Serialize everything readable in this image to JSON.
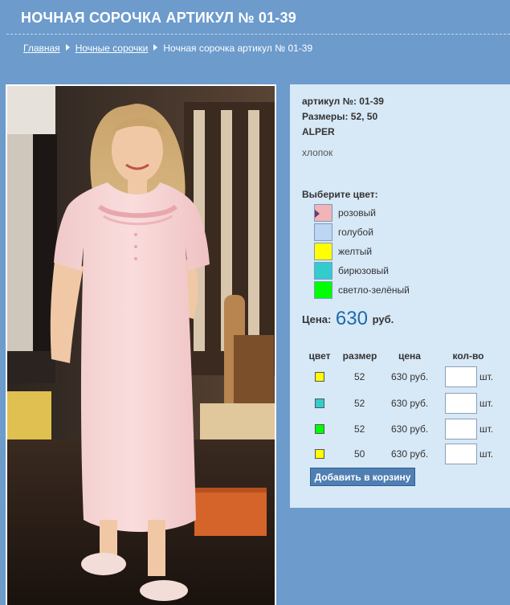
{
  "page": {
    "title": "НОЧНАЯ СОРОЧКА АРТИКУЛ № 01-39"
  },
  "breadcrumb": {
    "home": "Главная",
    "category": "Ночные сорочки",
    "current": "Ночная сорочка артикул № 01-39"
  },
  "product": {
    "article": "артикул №: 01-39",
    "sizes": "Размеры: 52, 50",
    "brand": "ALPER",
    "material": "хлопок",
    "image_alt": "pink short-sleeved nightgown worn by a model"
  },
  "color_picker": {
    "label": "Выберите цвет:",
    "colors": [
      {
        "name": "розовый",
        "hex": "#f2b4b6",
        "selected": true
      },
      {
        "name": "голубой",
        "hex": "#bcd6f3",
        "selected": false
      },
      {
        "name": "желтый",
        "hex": "#ffff00",
        "selected": false
      },
      {
        "name": "бирюзовый",
        "hex": "#33cccc",
        "selected": false
      },
      {
        "name": "светло-зелёный",
        "hex": "#00ff00",
        "selected": false
      }
    ]
  },
  "price": {
    "label": "Цена:",
    "amount": "630",
    "currency": "руб."
  },
  "variants": {
    "headers": {
      "color": "цвет",
      "size": "размер",
      "price": "цена",
      "qty": "кол-во"
    },
    "unit": "шт.",
    "rows": [
      {
        "color_hex": "#ffff00",
        "size": "52",
        "price": "630 руб.",
        "qty": ""
      },
      {
        "color_hex": "#33cccc",
        "size": "52",
        "price": "630 руб.",
        "qty": ""
      },
      {
        "color_hex": "#00ff00",
        "size": "52",
        "price": "630 руб.",
        "qty": ""
      },
      {
        "color_hex": "#ffff00",
        "size": "50",
        "price": "630 руб.",
        "qty": ""
      }
    ]
  },
  "cart": {
    "add_label": "Добавить в корзину"
  }
}
